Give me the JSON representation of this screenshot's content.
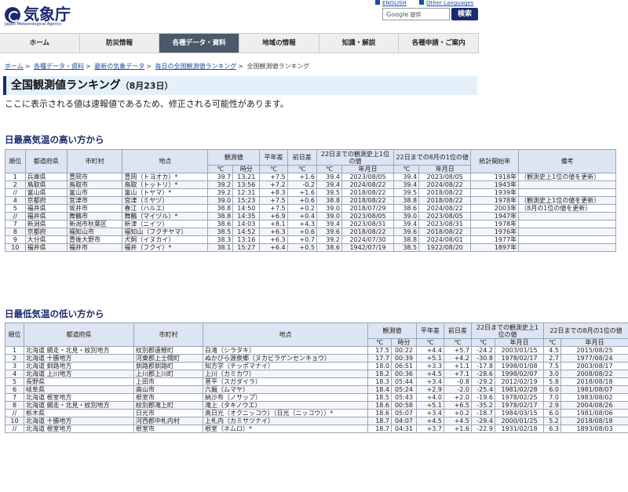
{
  "header": {
    "logo_text": "気象庁",
    "logo_sub": "Japan Meteorological Agency",
    "lang_links": [
      "ENGLISH",
      "Other Languages"
    ],
    "search_google": "Google",
    "search_provider": "提供",
    "search_button": "検索"
  },
  "nav": {
    "items": [
      "ホーム",
      "防災情報",
      "各種データ・資料",
      "地域の情報",
      "知識・解説",
      "各種申請・ご案内"
    ],
    "active_index": 2
  },
  "breadcrumb": {
    "links": [
      "ホーム",
      "各種データ・資料",
      "最新の気象データ",
      "毎日の全国観測値ランキング"
    ],
    "current": "全国観測値ランキング"
  },
  "page": {
    "title": "全国観測値ランキング",
    "date": "（8月23日）",
    "notice": "ここに表示される値は速報値であるため、修正される可能性があります。"
  },
  "high": {
    "heading": "日最高気温の高い方から",
    "headers": {
      "rank": "順位",
      "pref": "都道府県",
      "city": "市町村",
      "station": "地点",
      "obs": "観測値",
      "normal_diff": "平年差",
      "prev_diff": "前日差",
      "record_all": "22日までの観測史上1位の値",
      "record_aug": "22日までの8月の1位の値",
      "start_year": "統計開始年",
      "remarks": "備考",
      "unit_c": "℃",
      "unit_time": "時分",
      "unit_date": "年月日"
    },
    "rows": [
      {
        "rank": "1",
        "pref": "兵庫県",
        "city": "豊岡市",
        "station": "豊岡（トヨオカ）*",
        "val": "39.7",
        "time": "13:21",
        "normal": "+7.5",
        "prev": "+1.6",
        "rec_val": "39.4",
        "rec_date": "2023/08/05",
        "aug_val": "39.4",
        "aug_date": "2023/08/05",
        "start": "1918年",
        "note": "（観測史上1位の値を更新）"
      },
      {
        "rank": "2",
        "pref": "鳥取県",
        "city": "鳥取市",
        "station": "鳥取（トットリ）*",
        "val": "39.2",
        "time": "13:56",
        "normal": "+7.2",
        "prev": "-0.2",
        "rec_val": "39.4",
        "rec_date": "2024/08/22",
        "aug_val": "39.4",
        "aug_date": "2024/08/22",
        "start": "1943年",
        "note": ""
      },
      {
        "rank": "//",
        "pref": "富山県",
        "city": "富山市",
        "station": "富山（トヤマ）*",
        "val": "39.2",
        "time": "12:31",
        "normal": "+8.3",
        "prev": "+1.6",
        "rec_val": "39.5",
        "rec_date": "2018/08/22",
        "aug_val": "39.5",
        "aug_date": "2018/08/22",
        "start": "1939年",
        "note": ""
      },
      {
        "rank": "4",
        "pref": "京都府",
        "city": "宮津市",
        "station": "宮津（ミヤヅ）",
        "val": "39.0",
        "time": "15:23",
        "normal": "+7.5",
        "prev": "+0.6",
        "rec_val": "38.8",
        "rec_date": "2018/08/22",
        "aug_val": "38.8",
        "aug_date": "2018/08/22",
        "start": "1978年",
        "note": "（観測史上1位の値を更新）"
      },
      {
        "rank": "5",
        "pref": "福井県",
        "city": "坂井市",
        "station": "春江（ハルエ）",
        "val": "38.8",
        "time": "14:50",
        "normal": "+7.5",
        "prev": "+0.2",
        "rec_val": "39.0",
        "rec_date": "2018/07/29",
        "aug_val": "38.6",
        "aug_date": "2024/08/22",
        "start": "2003年",
        "note": "（8月の1位の値を更新）"
      },
      {
        "rank": "//",
        "pref": "福井県",
        "city": "舞鶴市",
        "station": "舞鶴（マイヅル）*",
        "val": "38.8",
        "time": "14:35",
        "normal": "+6.9",
        "prev": "+0.4",
        "rec_val": "39.0",
        "rec_date": "2023/08/05",
        "aug_val": "39.0",
        "aug_date": "2023/08/05",
        "start": "1947年",
        "note": ""
      },
      {
        "rank": "7",
        "pref": "新潟県",
        "city": "新潟市秋葉区",
        "station": "新津（ニイツ）",
        "val": "38.6",
        "time": "14:03",
        "normal": "+8.1",
        "prev": "+4.3",
        "rec_val": "39.4",
        "rec_date": "2023/08/31",
        "aug_val": "39.4",
        "aug_date": "2023/08/31",
        "start": "1978年",
        "note": ""
      },
      {
        "rank": "8",
        "pref": "京都府",
        "city": "福知山市",
        "station": "福知山（フクチヤマ）",
        "val": "38.5",
        "time": "14:52",
        "normal": "+6.3",
        "prev": "+0.6",
        "rec_val": "39.6",
        "rec_date": "2018/08/22",
        "aug_val": "39.6",
        "aug_date": "2018/08/22",
        "start": "1976年",
        "note": ""
      },
      {
        "rank": "9",
        "pref": "大分県",
        "city": "豊後大野市",
        "station": "犬飼（イヌカイ）",
        "val": "38.3",
        "time": "13:16",
        "normal": "+6.3",
        "prev": "+0.7",
        "rec_val": "39.2",
        "rec_date": "2024/07/30",
        "aug_val": "38.8",
        "aug_date": "2024/08/01",
        "start": "1977年",
        "note": ""
      },
      {
        "rank": "10",
        "pref": "福井県",
        "city": "福井市",
        "station": "福井（フクイ）*",
        "val": "38.1",
        "time": "15:27",
        "normal": "+6.4",
        "prev": "+0.5",
        "rec_val": "38.6",
        "rec_date": "1942/07/19",
        "aug_val": "38.5",
        "aug_date": "1922/08/20",
        "start": "1897年",
        "note": ""
      }
    ]
  },
  "low": {
    "heading": "日最低気温の低い方から",
    "headers": {
      "rank": "順位",
      "pref": "都道府県",
      "city": "市町村",
      "station": "地点",
      "obs": "観測値",
      "normal_diff": "平年差",
      "prev_diff": "前日差",
      "record_all": "22日までの観測史上1位の値",
      "record_aug": "22日までの8月の1位の値",
      "unit_c": "℃",
      "unit_time": "時分",
      "unit_date": "年月日"
    },
    "rows": [
      {
        "rank": "1",
        "pref": "北海道 網走・北見・紋別地方",
        "city": "紋別郡遠軽町",
        "station": "白滝（シラタキ）",
        "val": "17.5",
        "time": "00:22",
        "normal": "+4.4",
        "prev": "+5.7",
        "rec_val": "-24.2",
        "rec_date": "2003/01/15",
        "aug_val": "4.5",
        "aug_date": "2015/08/25"
      },
      {
        "rank": "2",
        "pref": "北海道 十勝地方",
        "city": "河東郡上士幌町",
        "station": "ぬかびら源泉郷（ヌカビラゲンセンキョウ）",
        "val": "17.7",
        "time": "00:39",
        "normal": "+5.1",
        "prev": "+4.2",
        "rec_val": "-30.8",
        "rec_date": "1978/02/17",
        "aug_val": "2.7",
        "aug_date": "1977/08/24"
      },
      {
        "rank": "3",
        "pref": "北海道 釧路地方",
        "city": "釧路郡釧路町",
        "station": "知方学（チッポマナイ）",
        "val": "18.0",
        "time": "06:51",
        "normal": "+3.3",
        "prev": "+1.1",
        "rec_val": "-17.8",
        "rec_date": "1998/01/08",
        "aug_val": "7.5",
        "aug_date": "2003/08/17"
      },
      {
        "rank": "4",
        "pref": "北海道 上川地方",
        "city": "上川郡上川町",
        "station": "上川（カミカワ）",
        "val": "18.2",
        "time": "00:36",
        "normal": "+4.5",
        "prev": "+7.1",
        "rec_val": "-28.6",
        "rec_date": "1998/02/07",
        "aug_val": "3.0",
        "aug_date": "2008/08/22"
      },
      {
        "rank": "5",
        "pref": "長野県",
        "city": "上田市",
        "station": "菅平（スガダイラ）",
        "val": "18.3",
        "time": "05:44",
        "normal": "+3.4",
        "prev": "-0.8",
        "rec_val": "-29.2",
        "rec_date": "2012/02/19",
        "aug_val": "5.8",
        "aug_date": "2018/08/18"
      },
      {
        "rank": "6",
        "pref": "岐阜県",
        "city": "高山市",
        "station": "六厩（ムマヤ）",
        "val": "18.4",
        "time": "05:24",
        "normal": "+2.9",
        "prev": "-2.0",
        "rec_val": "-25.4",
        "rec_date": "1981/02/28",
        "aug_val": "6.0",
        "aug_date": "1981/08/07"
      },
      {
        "rank": "7",
        "pref": "北海道 根室地方",
        "city": "根室市",
        "station": "納沙布（ノサップ）",
        "val": "18.5",
        "time": "05:43",
        "normal": "+4.0",
        "prev": "+2.0",
        "rec_val": "-19.6",
        "rec_date": "1978/02/25",
        "aug_val": "7.0",
        "aug_date": "1983/08/02"
      },
      {
        "rank": "8",
        "pref": "北海道 網走・北見・紋別地方",
        "city": "紋別郡滝上町",
        "station": "滝上（タキノウエ）",
        "val": "18.6",
        "time": "00:58",
        "normal": "+5.1",
        "prev": "+6.5",
        "rec_val": "-35.2",
        "rec_date": "1978/02/17",
        "aug_val": "2.9",
        "aug_date": "2004/08/26"
      },
      {
        "rank": "//",
        "pref": "栃木県",
        "city": "日光市",
        "station": "奥日光（オクニッコウ）（日光（ニッコウ））*",
        "val": "18.6",
        "time": "05:07",
        "normal": "+3.4",
        "prev": "+0.2",
        "rec_val": "-18.7",
        "rec_date": "1984/03/15",
        "aug_val": "6.0",
        "aug_date": "1981/08/06"
      },
      {
        "rank": "10",
        "pref": "北海道 十勝地方",
        "city": "河西郡中札内村",
        "station": "上札内（カミサツナイ）",
        "val": "18.7",
        "time": "04:07",
        "normal": "+4.5",
        "prev": "+4.5",
        "rec_val": "-29.4",
        "rec_date": "2000/01/25",
        "aug_val": "5.2",
        "aug_date": "2018/08/18"
      },
      {
        "rank": "//",
        "pref": "北海道 根室地方",
        "city": "根室市",
        "station": "根室（ネムロ）*",
        "val": "18.7",
        "time": "04:31",
        "normal": "+3.7",
        "prev": "+1.6",
        "rec_val": "-22.9",
        "rec_date": "1931/02/18",
        "aug_val": "6.3",
        "aug_date": "1893/08/03"
      }
    ]
  }
}
